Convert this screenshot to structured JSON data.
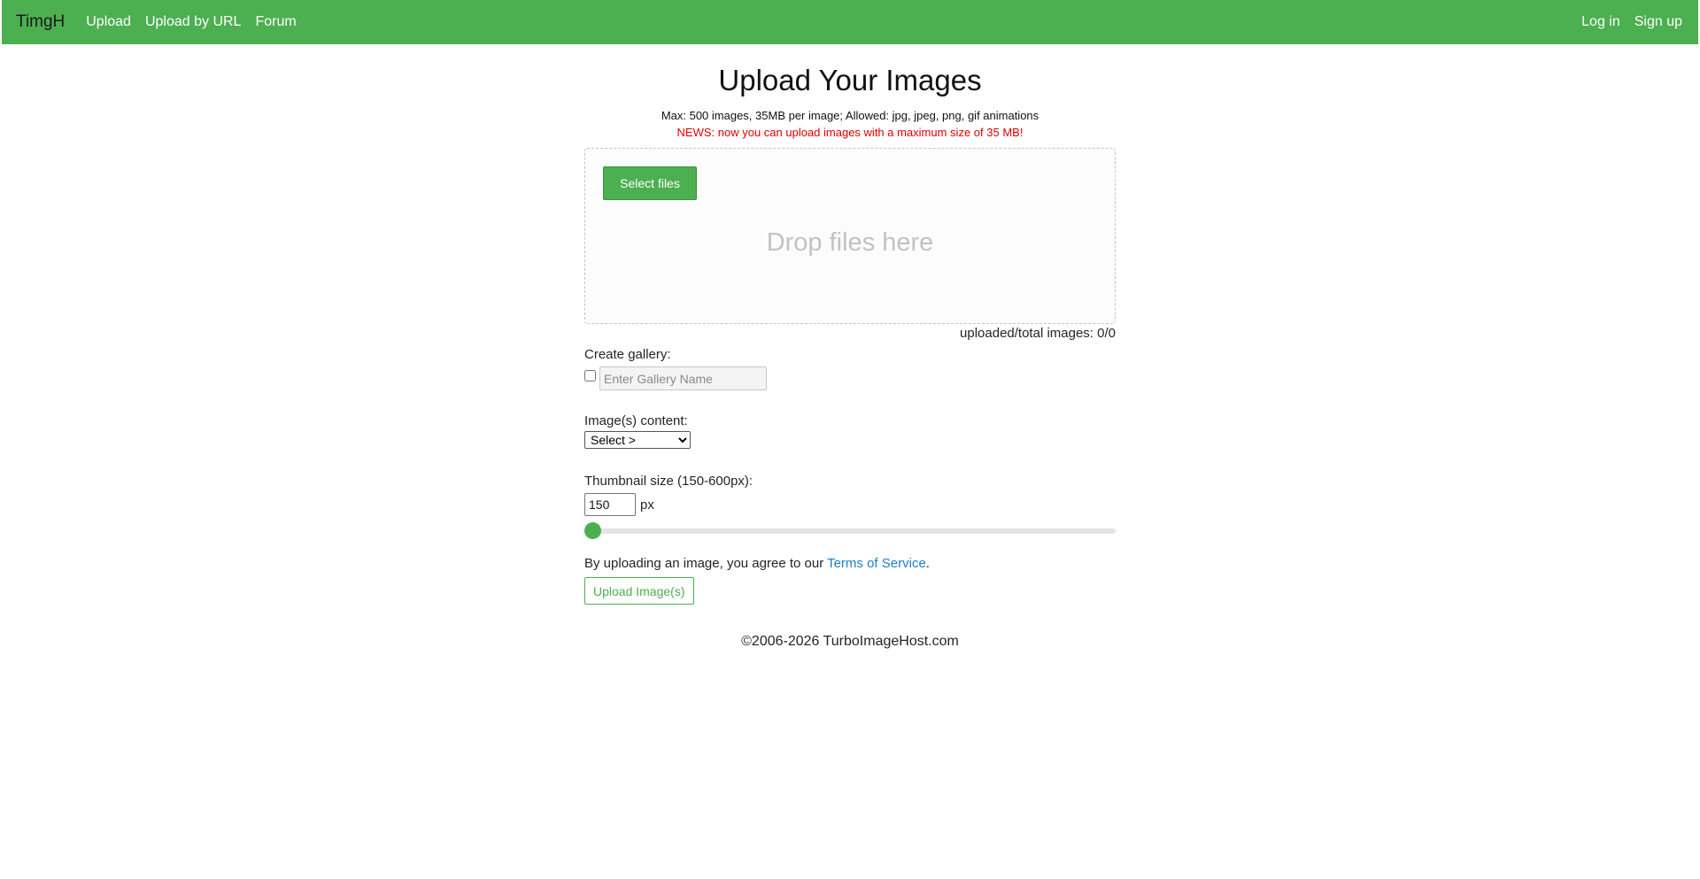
{
  "nav": {
    "brand": "TimgH",
    "left_links": [
      "Upload",
      "Upload by URL",
      "Forum"
    ],
    "right_links": [
      "Log in",
      "Sign up"
    ],
    "bar_color": "#4caf50"
  },
  "main": {
    "title": "Upload Your Images",
    "limits": "Max: 500 images, 35MB per image; Allowed: jpg, jpeg, png, gif animations",
    "news": "NEWS: now you can upload images with a maximum size of 35 MB!"
  },
  "dropzone": {
    "select_label": "Select files",
    "drop_text": "Drop files here"
  },
  "counter": {
    "text": "uploaded/total images: 0/0"
  },
  "gallery": {
    "label": "Create gallery:",
    "checked": false,
    "placeholder": "Enter Gallery Name",
    "value": ""
  },
  "content": {
    "label": "Image(s) content:",
    "selected": "Select >"
  },
  "thumbnail": {
    "label": "Thumbnail size (150-600px):",
    "value": "150",
    "unit": "px",
    "min": 150,
    "max": 600,
    "current": 150
  },
  "terms": {
    "prefix": "By uploading an image, you agree to our ",
    "link_text": "Terms of Service",
    "suffix": "."
  },
  "upload_button": {
    "label": "Upload Image(s)"
  },
  "footer": {
    "text": "©2006-2026 TurboImageHost.com"
  },
  "colors": {
    "accent": "#4caf50",
    "news": "#e00000",
    "link": "#1a7fc9"
  }
}
